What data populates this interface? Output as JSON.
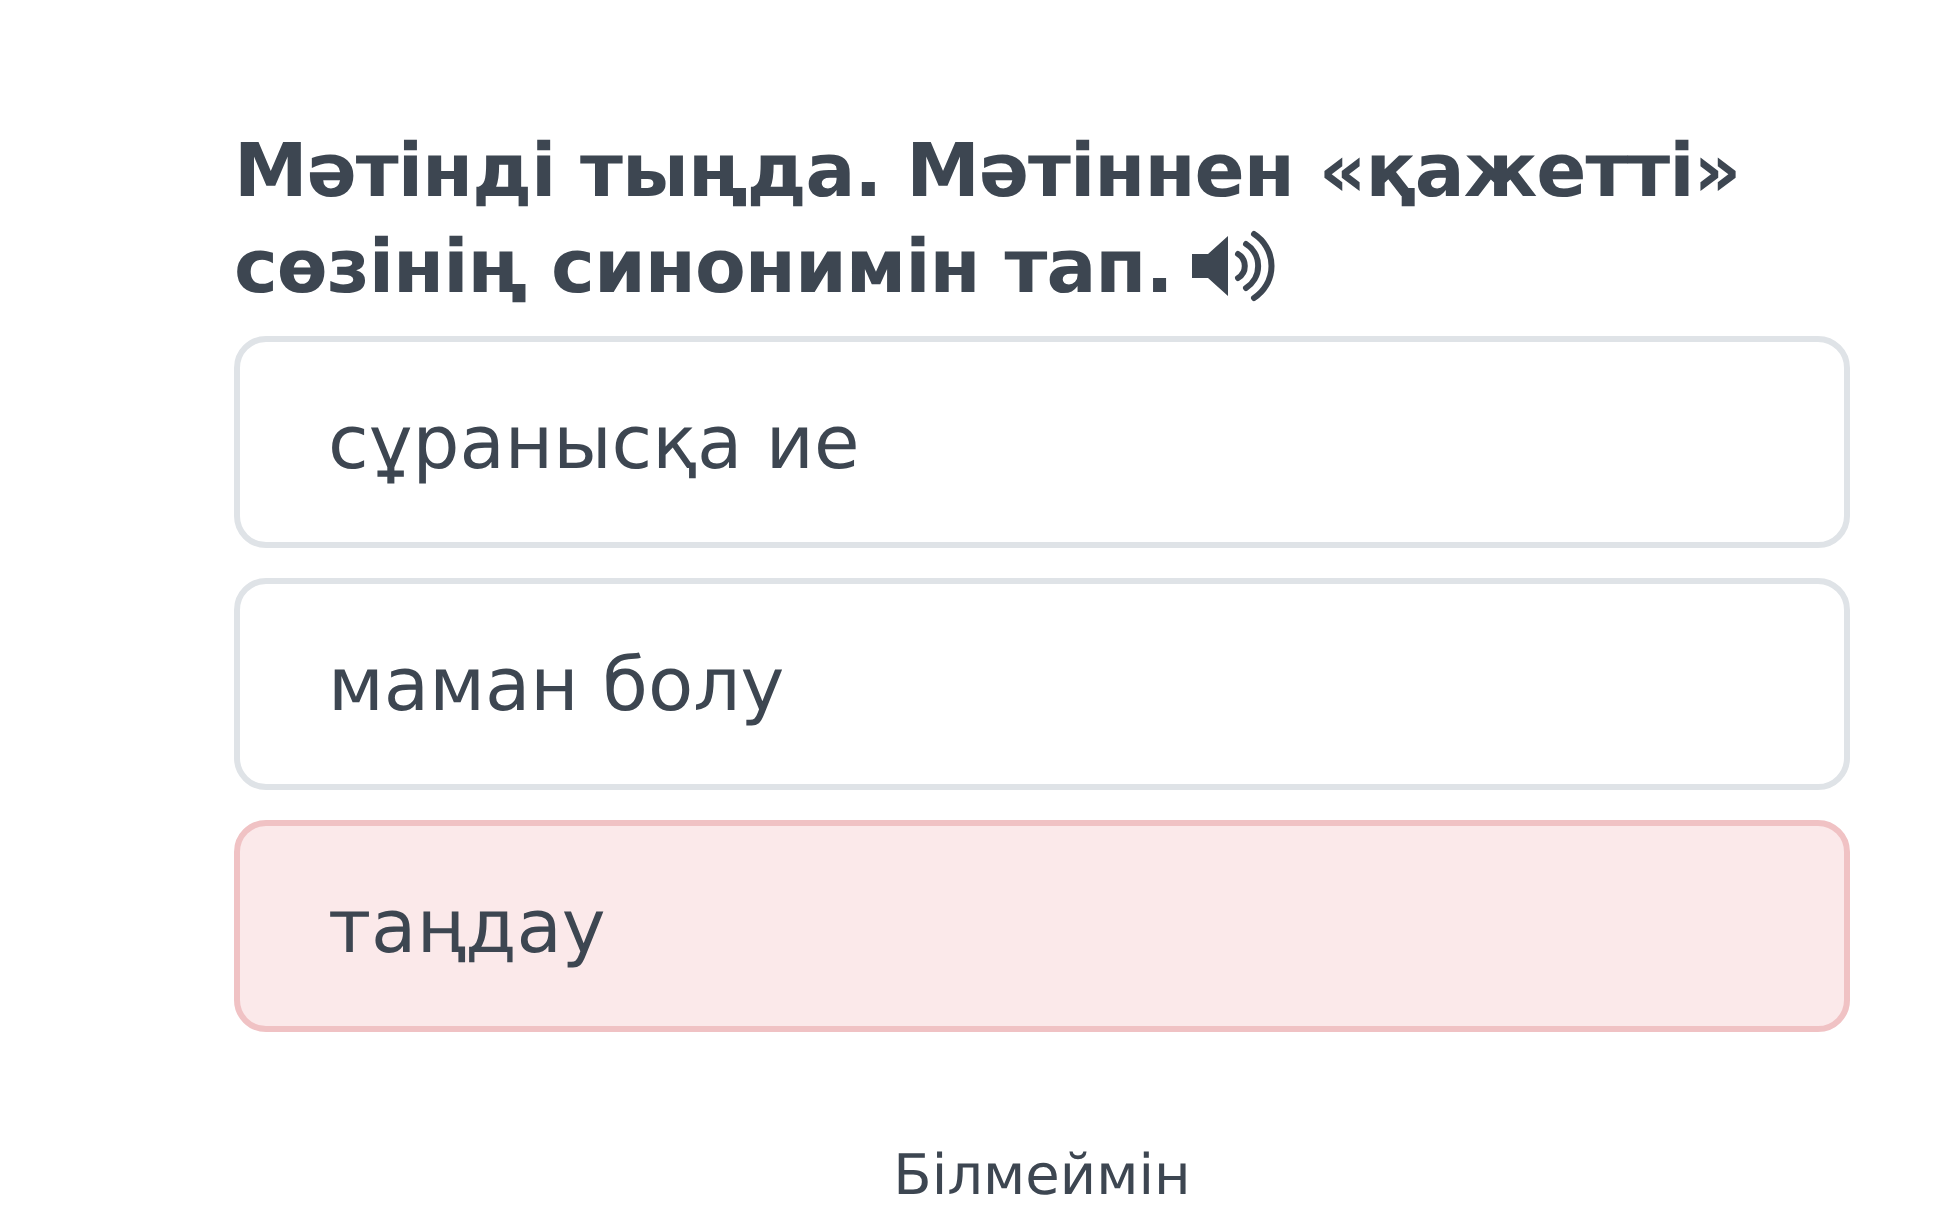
{
  "question": {
    "text": "Мәтінді тыңда. Мәтіннен «қажетті» сөзінің синонимін тап."
  },
  "options": [
    {
      "label": "сұранысқа ие",
      "selected": false
    },
    {
      "label": "маман болу",
      "selected": false
    },
    {
      "label": "таңдау",
      "selected": true
    }
  ],
  "skip_link": "Білмеймін"
}
